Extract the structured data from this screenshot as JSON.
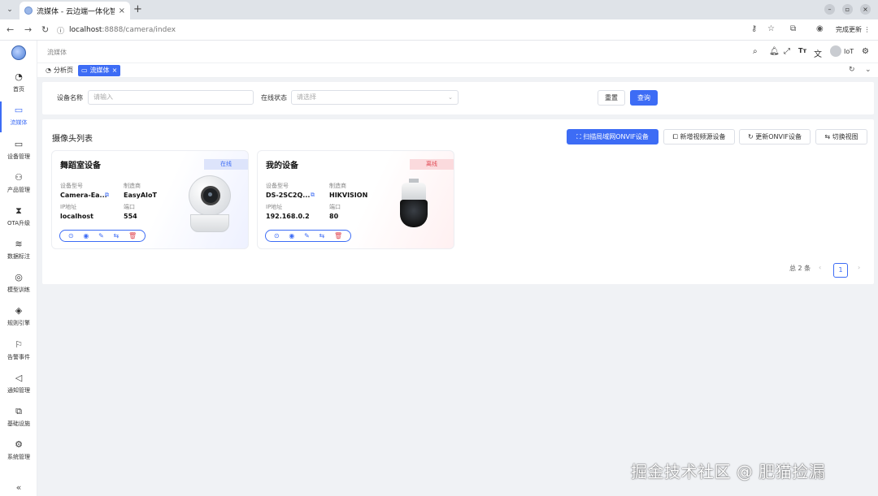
{
  "browser": {
    "tab_title": "流媒体 - 云边端一体化智",
    "tab_close": "×",
    "new_tab": "+",
    "url_host": "localhost",
    "url_path": ":8888/camera/index",
    "update_label": "完成更新"
  },
  "sidebar": {
    "items": [
      {
        "label": "首页",
        "icon": "◔"
      },
      {
        "label": "流媒体",
        "icon": "▭"
      },
      {
        "label": "设备管理",
        "icon": "▭"
      },
      {
        "label": "产品管理",
        "icon": "⚇"
      },
      {
        "label": "OTA升级",
        "icon": "⧗"
      },
      {
        "label": "数据标注",
        "icon": "≋"
      },
      {
        "label": "模型训练",
        "icon": "◎"
      },
      {
        "label": "规则引擎",
        "icon": "◈"
      },
      {
        "label": "告警事件",
        "icon": "⚐"
      },
      {
        "label": "通知管理",
        "icon": "◁"
      },
      {
        "label": "基础设施",
        "icon": "⧉"
      },
      {
        "label": "系统管理",
        "icon": "⚙"
      }
    ],
    "collapse_icon": "«"
  },
  "header": {
    "breadcrumb": "流媒体",
    "username": "IoT"
  },
  "tags": {
    "analysis": "分析页",
    "active": "流媒体",
    "active_close": "×"
  },
  "search": {
    "name_label": "设备名称",
    "name_placeholder": "请输入",
    "status_label": "在线状态",
    "status_placeholder": "请选择",
    "reset": "重置",
    "query": "查询"
  },
  "list": {
    "title": "摄像头列表",
    "actions": {
      "scan": "扫描局域网ONVIF设备",
      "add": "新增视频源设备",
      "refresh": "更新ONVIF设备",
      "switch_view": "切换视图"
    },
    "field_labels": {
      "model": "设备型号",
      "maker": "制造商",
      "ip": "IP地址",
      "port": "端口"
    },
    "cards": [
      {
        "name": "舞蹈室设备",
        "status": "在线",
        "model": "Camera-Ea...",
        "maker": "EasyAIoT",
        "ip": "localhost",
        "port": "554"
      },
      {
        "name": "我的设备",
        "status": "离线",
        "model": "DS-2SC2Q...",
        "maker": "HIKVISION",
        "ip": "192.168.0.2",
        "port": "80"
      }
    ],
    "pagination": {
      "total": "总 2 条",
      "current": "1"
    }
  },
  "watermark": "掘金技术社区 @ 肥猫捡漏",
  "colors": {
    "primary": "#3d6cf5",
    "offline": "#e04b55"
  }
}
